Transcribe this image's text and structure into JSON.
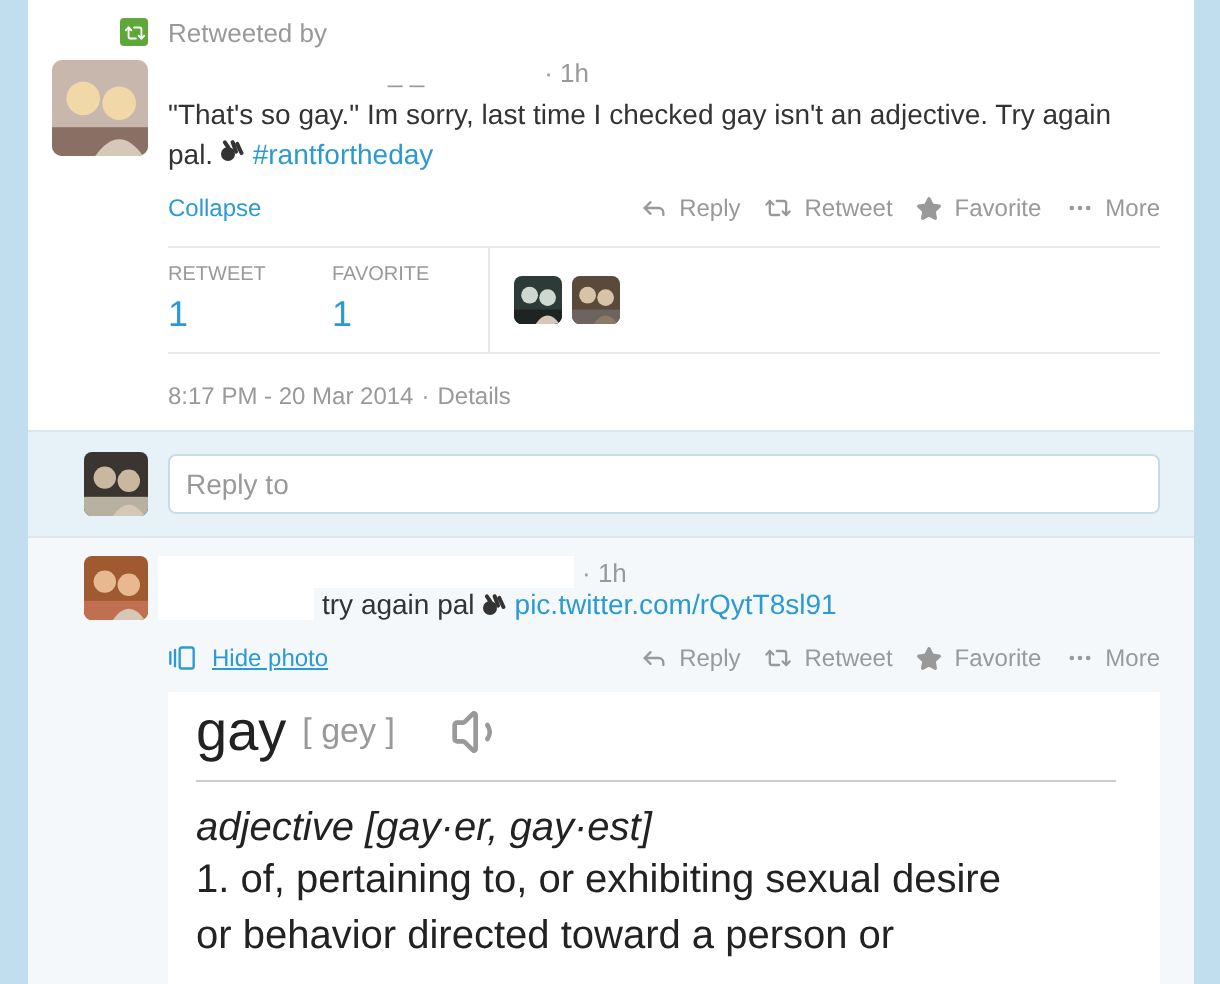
{
  "retweet_header": {
    "label": "Retweeted by"
  },
  "main_tweet": {
    "name_marks": "_ _",
    "time": "· 1h",
    "text": "\"That's so gay.\" Im sorry, last time I checked gay isn't an adjective. Try again pal.",
    "hashtag": "#rantfortheday",
    "toggle": "Collapse",
    "actions": [
      {
        "kind": "reply",
        "label": "Reply"
      },
      {
        "kind": "retweet",
        "label": "Retweet"
      },
      {
        "kind": "favorite",
        "label": "Favorite"
      },
      {
        "kind": "more",
        "label": "More"
      }
    ],
    "stats": [
      {
        "label": "RETWEET",
        "count": "1"
      },
      {
        "label": "FAVORITE",
        "count": "1"
      }
    ],
    "timestamp": "8:17 PM - 20 Mar 2014",
    "separator": "·",
    "details": "Details"
  },
  "reply_box": {
    "placeholder": "Reply to"
  },
  "reply_tweet": {
    "time": "· 1h",
    "text": "try again pal",
    "link": "pic.twitter.com/rQytT8sl91",
    "toggle": "Hide photo",
    "actions": [
      {
        "kind": "reply",
        "label": "Reply"
      },
      {
        "kind": "retweet",
        "label": "Retweet"
      },
      {
        "kind": "favorite",
        "label": "Favorite"
      },
      {
        "kind": "more",
        "label": "More"
      }
    ]
  },
  "photo": {
    "word": "gay",
    "pronunciation": "[ gey ]",
    "part_of_speech": "adjective [gay·er, gay·est]",
    "definition_lines": [
      "1. of, pertaining to, or exhibiting sexual desire",
      "or behavior directed toward a person or"
    ]
  }
}
